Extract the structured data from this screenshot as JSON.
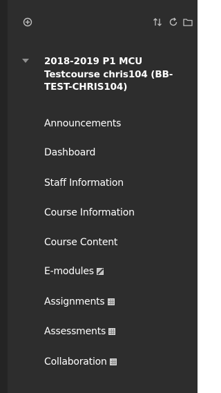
{
  "toolbar": {
    "icons": [
      "add-circle-icon",
      "sort-arrows-icon",
      "refresh-icon",
      "folder-icon"
    ]
  },
  "course": {
    "title": "2018-2019 P1 MCU Testcourse chris104 (BB-TEST-CHRIS104)",
    "expanded": true
  },
  "menu": {
    "items": [
      {
        "label": "Announcements",
        "badge": null
      },
      {
        "label": "Dashboard",
        "badge": null
      },
      {
        "label": "Staff Information",
        "badge": null
      },
      {
        "label": "Course Information",
        "badge": null
      },
      {
        "label": "Course Content",
        "badge": null
      },
      {
        "label": "E-modules",
        "badge": "hidden-icon"
      },
      {
        "label": "Assignments",
        "badge": "empty-icon"
      },
      {
        "label": "Assessments",
        "badge": "empty-icon"
      },
      {
        "label": "Collaboration",
        "badge": "empty-icon"
      }
    ]
  },
  "colors": {
    "panel_bg": "#2d2d2d",
    "panel_edge": "#242424",
    "text": "#ffffff",
    "icon": "#bfbfbf"
  }
}
